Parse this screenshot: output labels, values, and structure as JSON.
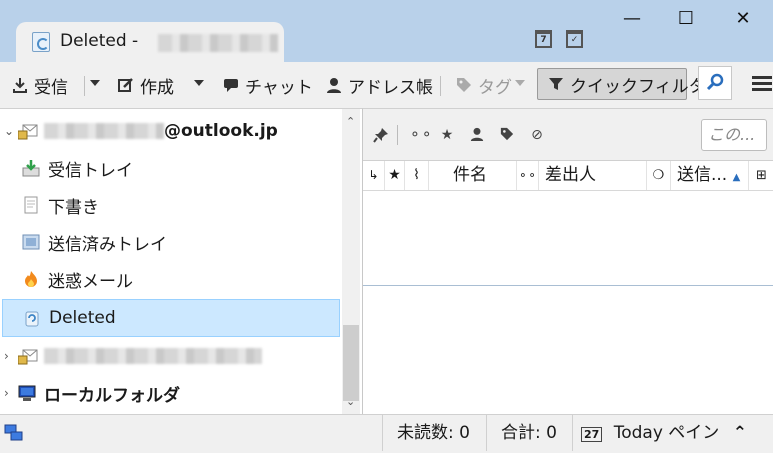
{
  "window": {
    "tab_title": "Deleted -",
    "minimize": "—",
    "maximize": "☐",
    "close": "✕"
  },
  "toolbar": {
    "get_messages": "受信",
    "write": "作成",
    "chat": "チャット",
    "address_book": "アドレス帳",
    "tag": "タグ",
    "quick_filter": "クイックフィルタ"
  },
  "folders": {
    "account_suffix": "@outlook.jp",
    "items": [
      {
        "label": "受信トレイ",
        "icon": "inbox-icon"
      },
      {
        "label": "下書き",
        "icon": "drafts-icon"
      },
      {
        "label": "送信済みトレイ",
        "icon": "sent-icon"
      },
      {
        "label": "迷惑メール",
        "icon": "junk-icon"
      },
      {
        "label": "Deleted",
        "icon": "trash-icon",
        "selected": true
      }
    ],
    "local_folders": "ローカルフォルダ"
  },
  "quick_filter": {
    "search_placeholder": "この..."
  },
  "columns": {
    "subject": "件名",
    "sender": "差出人",
    "date": "送信..."
  },
  "status": {
    "unread": "未読数: 0",
    "total": "合計: 0",
    "today_pane": "Today ペイン",
    "today_pane_caret": "⌃"
  },
  "colors": {
    "titlebar": "#b9d1ea",
    "selection": "#cce8ff",
    "selection_border": "#99d1ff",
    "search_icon": "#2a6ebd"
  }
}
